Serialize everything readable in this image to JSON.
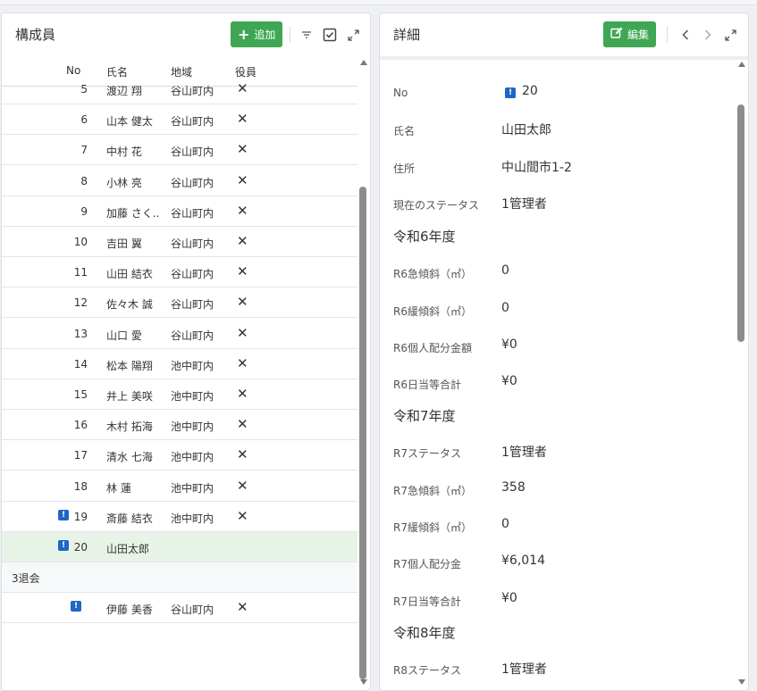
{
  "members": {
    "title": "構成員",
    "add_label": "追加",
    "columns": {
      "no": "No",
      "name": "氏名",
      "area": "地域",
      "officer": "役員"
    },
    "rows": [
      {
        "no": "5",
        "name": "渡辺 翔",
        "area": "谷山町内",
        "officer": "✕"
      },
      {
        "no": "6",
        "name": "山本 健太",
        "area": "谷山町内",
        "officer": "✕"
      },
      {
        "no": "7",
        "name": "中村 花",
        "area": "谷山町内",
        "officer": "✕"
      },
      {
        "no": "8",
        "name": "小林 亮",
        "area": "谷山町内",
        "officer": "✕"
      },
      {
        "no": "9",
        "name": "加藤 さく...",
        "area": "谷山町内",
        "officer": "✕"
      },
      {
        "no": "10",
        "name": "吉田 翼",
        "area": "谷山町内",
        "officer": "✕"
      },
      {
        "no": "11",
        "name": "山田 結衣",
        "area": "谷山町内",
        "officer": "✕"
      },
      {
        "no": "12",
        "name": "佐々木 誠",
        "area": "谷山町内",
        "officer": "✕"
      },
      {
        "no": "13",
        "name": "山口 愛",
        "area": "谷山町内",
        "officer": "✕"
      },
      {
        "no": "14",
        "name": "松本 陽翔",
        "area": "池中町内",
        "officer": "✕"
      },
      {
        "no": "15",
        "name": "井上 美咲",
        "area": "池中町内",
        "officer": "✕"
      },
      {
        "no": "16",
        "name": "木村 拓海",
        "area": "池中町内",
        "officer": "✕"
      },
      {
        "no": "17",
        "name": "清水 七海",
        "area": "池中町内",
        "officer": "✕"
      },
      {
        "no": "18",
        "name": "林 蓮",
        "area": "池中町内",
        "officer": "✕"
      },
      {
        "no": "19",
        "name": "斎藤 結衣",
        "area": "池中町内",
        "officer": "✕",
        "warn": true
      },
      {
        "no": "20",
        "name": "山田太郎",
        "area": "",
        "officer": "",
        "warn": true,
        "selected": true
      }
    ],
    "group_label": "3退会",
    "group_rows": [
      {
        "no": "",
        "name": "伊藤 美香",
        "area": "谷山町内",
        "officer": "✕",
        "warn": true
      }
    ]
  },
  "detail": {
    "title": "詳細",
    "edit_label": "編集",
    "fields": [
      {
        "label": "No",
        "value": "20",
        "warn": true
      },
      {
        "label": "氏名",
        "value": "山田太郎"
      },
      {
        "label": "住所",
        "value": "中山間市1-2"
      },
      {
        "label": "現在のステータス",
        "value": "1管理者"
      }
    ],
    "sections": [
      {
        "title": "令和6年度",
        "fields": [
          {
            "label": "R6急傾斜（㎡）",
            "value": "0"
          },
          {
            "label": "R6緩傾斜（㎡）",
            "value": "0"
          },
          {
            "label": "R6個人配分金額",
            "value": "¥0"
          },
          {
            "label": "R6日当等合計",
            "value": "¥0"
          }
        ]
      },
      {
        "title": "令和7年度",
        "fields": [
          {
            "label": "R7ステータス",
            "value": "1管理者"
          },
          {
            "label": "R7急傾斜（㎡）",
            "value": "358"
          },
          {
            "label": "R7緩傾斜（㎡）",
            "value": "0"
          },
          {
            "label": "R7個人配分金",
            "value": "¥6,014"
          },
          {
            "label": "R7日当等合計",
            "value": "¥0"
          }
        ]
      },
      {
        "title": "令和8年度",
        "fields": [
          {
            "label": "R8ステータス",
            "value": "1管理者"
          }
        ]
      }
    ]
  },
  "colors": {
    "accent_green": "#3fa653",
    "warn_blue": "#1f66c5",
    "selected_row": "#e8f3e8"
  },
  "icons": [
    "plus-icon",
    "filter-icon",
    "checkbox-icon",
    "expand-icon",
    "edit-icon",
    "chevron-left-icon",
    "chevron-right-icon",
    "warning-icon",
    "close-icon"
  ]
}
